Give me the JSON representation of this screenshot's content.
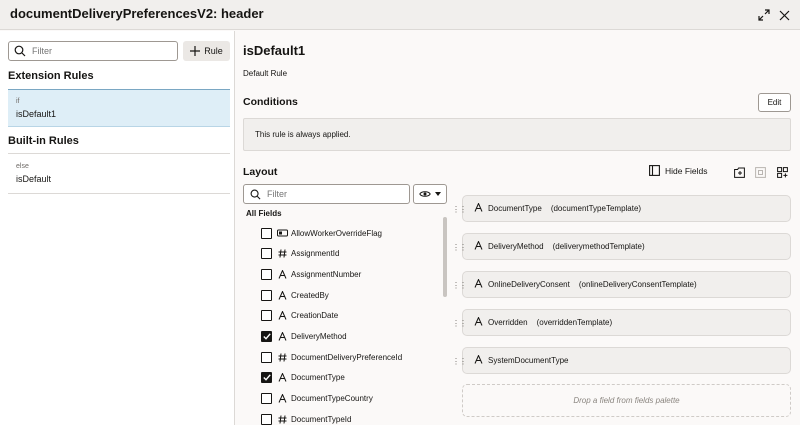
{
  "window": {
    "title": "documentDeliveryPreferencesV2: header"
  },
  "left": {
    "filter_placeholder": "Filter",
    "add_rule_label": "Rule",
    "extension_header": "Extension Rules",
    "extension_rules": [
      {
        "keyword": "if",
        "name": "isDefault1"
      }
    ],
    "builtin_header": "Built-in Rules",
    "builtin_rules": [
      {
        "keyword": "else",
        "name": "isDefault"
      }
    ]
  },
  "rule": {
    "title": "isDefault1",
    "subtitle": "Default Rule",
    "conditions_header": "Conditions",
    "edit_label": "Edit",
    "condition_text": "This rule is always applied."
  },
  "layout": {
    "header": "Layout",
    "hide_fields_label": "Hide Fields",
    "filter_placeholder": "Filter",
    "all_fields_label": "All Fields",
    "fields": [
      {
        "name": "AllowWorkerOverrideFlag",
        "type": "boolean",
        "checked": false
      },
      {
        "name": "AssignmentId",
        "type": "number",
        "checked": false
      },
      {
        "name": "AssignmentNumber",
        "type": "text",
        "checked": false
      },
      {
        "name": "CreatedBy",
        "type": "text",
        "checked": false
      },
      {
        "name": "CreationDate",
        "type": "text",
        "checked": false
      },
      {
        "name": "DeliveryMethod",
        "type": "text",
        "checked": true
      },
      {
        "name": "DocumentDeliveryPreferenceId",
        "type": "number",
        "checked": false
      },
      {
        "name": "DocumentType",
        "type": "text",
        "checked": true
      },
      {
        "name": "DocumentTypeCountry",
        "type": "text",
        "checked": false
      },
      {
        "name": "DocumentTypeId",
        "type": "number",
        "checked": false
      }
    ],
    "cards": [
      {
        "name": "DocumentType",
        "template": "(documentTypeTemplate)"
      },
      {
        "name": "DeliveryMethod",
        "template": "(deliverymethodTemplate)"
      },
      {
        "name": "OnlineDeliveryConsent",
        "template": "(onlineDeliveryConsentTemplate)"
      },
      {
        "name": "Overridden",
        "template": "(overriddenTemplate)"
      },
      {
        "name": "SystemDocumentType",
        "template": ""
      }
    ],
    "drop_placeholder": "Drop a field from fields palette"
  }
}
